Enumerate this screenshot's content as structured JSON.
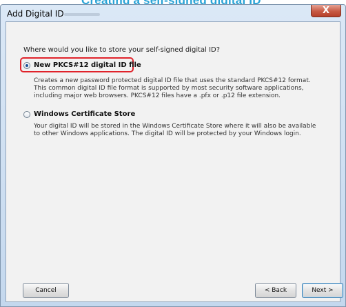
{
  "banner": {
    "text": "Creating a self-signed digital ID"
  },
  "window": {
    "title": "Add Digital ID",
    "close_symbol": "X"
  },
  "prompt": "Where would you like to store your self-signed digital ID?",
  "options": [
    {
      "label": "New PKCS#12 digital ID file",
      "selected": true,
      "description": [
        "Creates a new password protected digital ID file that uses the standard PKCS#12 format.",
        "This common digital ID file format is supported by most security software applications,",
        "including major web browsers. PKCS#12 files have a .pfx or .p12 file extension."
      ]
    },
    {
      "label": "Windows Certificate Store",
      "selected": false,
      "description": [
        "Your digital ID will be stored in the Windows Certificate Store where it will also be available",
        "to other Windows applications. The digital ID will be protected by your Windows login."
      ]
    }
  ],
  "buttons": {
    "cancel": "Cancel",
    "back": "< Back",
    "next": "Next >"
  },
  "colors": {
    "highlight": "#e0222a",
    "banner_text": "#2aa3d6",
    "titlebar": "#c4d8ee",
    "close_button": "#c75a44"
  },
  "icons": {
    "close": "close-icon"
  }
}
